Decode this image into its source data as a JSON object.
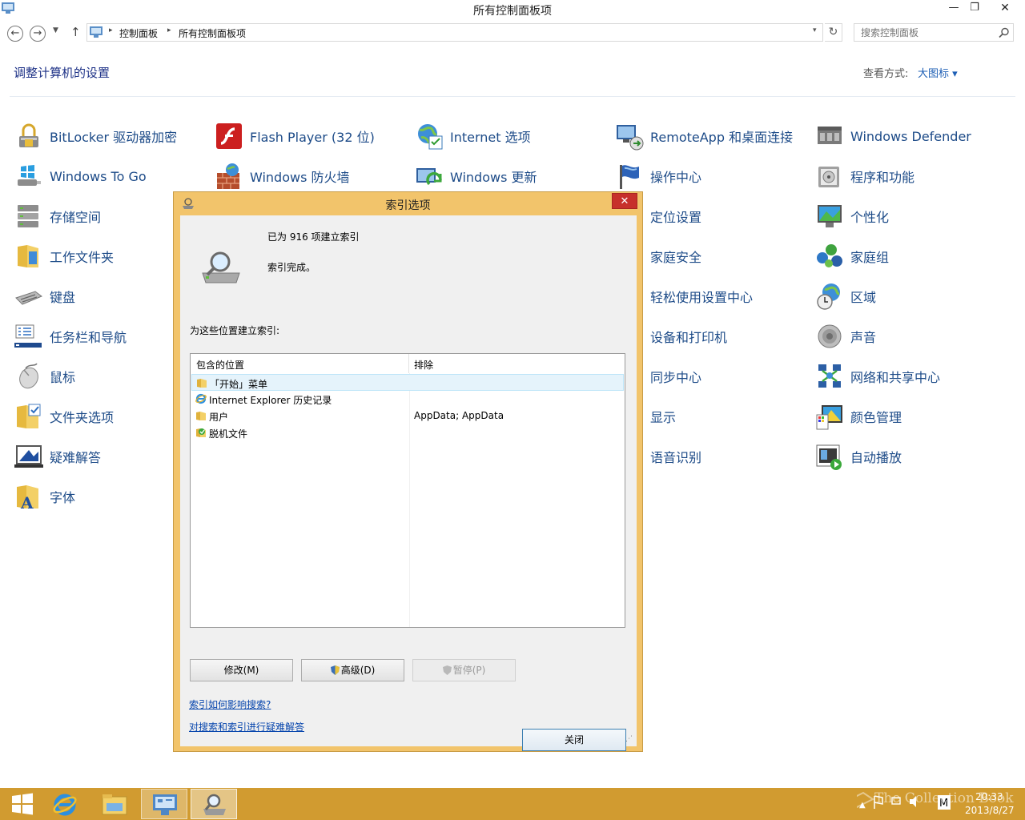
{
  "window": {
    "title": "所有控制面板项",
    "min": "—",
    "max": "❐",
    "close": "✕"
  },
  "address": {
    "back": "←",
    "forward": "→",
    "recent": "▼",
    "up": "↑",
    "crumbs": [
      "控制面板",
      "所有控制面板项"
    ],
    "sep": "▸",
    "dropdown": "▾",
    "refresh": "↻",
    "search_placeholder": "搜索控制面板"
  },
  "page": {
    "heading": "调整计算机的设置",
    "view_by_label": "查看方式:",
    "view_by_value": "大图标 ▾"
  },
  "items": [
    {
      "label": "BitLocker 驱动器加密",
      "icon": "bitlocker-icon"
    },
    {
      "label": "Flash Player (32 位)",
      "icon": "flash-icon"
    },
    {
      "label": "Internet 选项",
      "icon": "internet-options-icon"
    },
    {
      "label": "RemoteApp 和桌面连接",
      "icon": "remoteapp-icon"
    },
    {
      "label": "Windows Defender",
      "icon": "defender-icon"
    },
    {
      "label": "Windows To Go",
      "icon": "windows-to-go-icon"
    },
    {
      "label": "Windows 防火墙",
      "icon": "firewall-icon"
    },
    {
      "label": "Windows 更新",
      "icon": "windows-update-icon"
    },
    {
      "label": "操作中心",
      "icon": "action-center-icon"
    },
    {
      "label": "程序和功能",
      "icon": "programs-icon"
    },
    {
      "label": "存储空间",
      "icon": "storage-spaces-icon"
    },
    {
      "label": "定位设置",
      "icon": "location-icon"
    },
    {
      "label": "个性化",
      "icon": "personalization-icon"
    },
    {
      "label": "工作文件夹",
      "icon": "work-folders-icon"
    },
    {
      "label": "家庭安全",
      "icon": "family-safety-icon"
    },
    {
      "label": "家庭组",
      "icon": "homegroup-icon"
    },
    {
      "label": "键盘",
      "icon": "keyboard-icon"
    },
    {
      "label": "轻松使用设置中心",
      "icon": "ease-of-access-icon"
    },
    {
      "label": "区域",
      "icon": "region-icon"
    },
    {
      "label": "任务栏和导航",
      "icon": "taskbar-icon"
    },
    {
      "label": "设备和打印机",
      "icon": "devices-icon"
    },
    {
      "label": "声音",
      "icon": "sound-icon"
    },
    {
      "label": "鼠标",
      "icon": "mouse-icon"
    },
    {
      "label": "同步中心",
      "icon": "sync-center-icon"
    },
    {
      "label": "网络和共享中心",
      "icon": "network-icon"
    },
    {
      "label": "文件夹选项",
      "icon": "folder-options-icon"
    },
    {
      "label": "显示",
      "icon": "display-icon"
    },
    {
      "label": "颜色管理",
      "icon": "color-management-icon"
    },
    {
      "label": "疑难解答",
      "icon": "troubleshooting-icon"
    },
    {
      "label": "语音识别",
      "icon": "speech-icon"
    },
    {
      "label": "自动播放",
      "icon": "autoplay-icon"
    },
    {
      "label": "字体",
      "icon": "fonts-icon"
    }
  ],
  "dialog": {
    "title": "索引选项",
    "close": "✕",
    "indexed_count": "已为 916 项建立索引",
    "status": "索引完成。",
    "locations_label": "为这些位置建立索引:",
    "col_included": "包含的位置",
    "col_excluded": "排除",
    "rows": [
      {
        "name": "「开始」菜单",
        "exclude": "",
        "icon": "folder-icon"
      },
      {
        "name": "Internet Explorer 历史记录",
        "exclude": "",
        "icon": "ie-icon"
      },
      {
        "name": "用户",
        "exclude": "AppData; AppData",
        "icon": "folder-icon"
      },
      {
        "name": "脱机文件",
        "exclude": "",
        "icon": "offline-files-icon"
      }
    ],
    "btn_modify": "修改(M)",
    "btn_advanced": "高级(D)",
    "btn_pause": "暂停(P)",
    "link_how": "索引如何影响搜索?",
    "link_trouble": "对搜索和索引进行疑难解答",
    "btn_close": "关闭"
  },
  "taskbar": {
    "watermark": "The Collection Book",
    "time": "20:33",
    "date": "2013/8/27"
  },
  "colors": {
    "accent": "#1d4b88",
    "dialog_frame": "#f2c46b",
    "taskbar": "#d19b30"
  }
}
